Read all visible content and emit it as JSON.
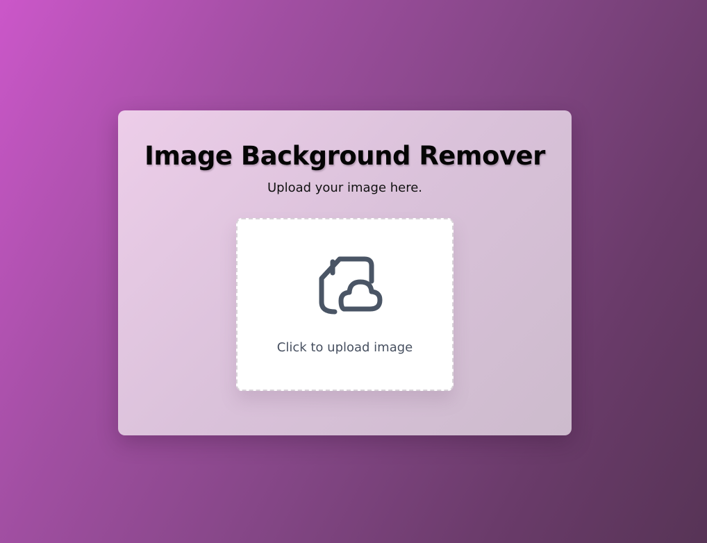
{
  "card": {
    "title": "Image Background Remover",
    "subtitle": "Upload your image here."
  },
  "upload": {
    "icon": "file-cloud-upload-icon",
    "label": "Click to upload image"
  },
  "colors": {
    "background_start": "#cb57c9",
    "background_end": "#573456",
    "card": "#e5cfe3",
    "upload_box": "#ffffff",
    "icon": "#4a5565",
    "title_text": "#050505"
  }
}
